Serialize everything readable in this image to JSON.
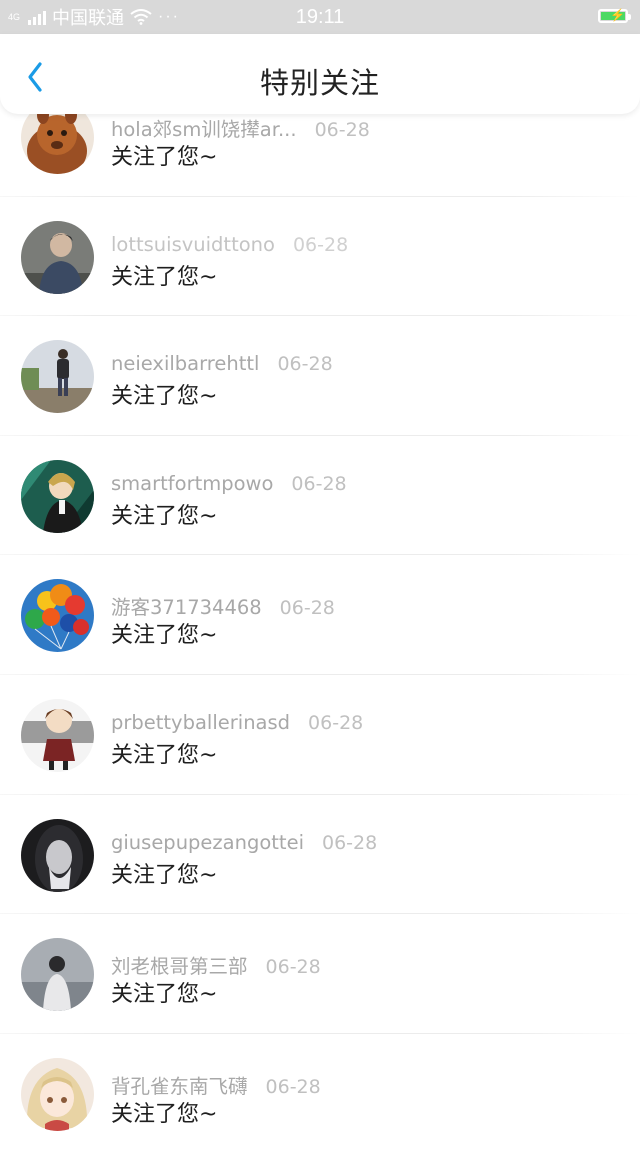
{
  "status_bar": {
    "signal_tag": "4G",
    "carrier": "中国联通",
    "more": "···",
    "time": "19:11",
    "battery_color": "#4cd964"
  },
  "header": {
    "title": "特别关注",
    "back_icon": "chevron-left-icon",
    "accent_color": "#1a9be6"
  },
  "list": {
    "items": [
      {
        "name": "hola郊sm训饶撵ar...",
        "date": "06-28",
        "message": "关注了您~",
        "avatar": "alpaca-avatar"
      },
      {
        "name": "lottsuisvuidttono",
        "date": "06-28",
        "message": "关注了您~",
        "avatar": "person-avatar"
      },
      {
        "name": "neiexilbarrehttl",
        "date": "06-28",
        "message": "关注了您~",
        "avatar": "backpacker-avatar"
      },
      {
        "name": "smartfortmpowo",
        "date": "06-28",
        "message": "关注了您~",
        "avatar": "anime-avatar"
      },
      {
        "name": "游客371734468",
        "date": "06-28",
        "message": "关注了您~",
        "avatar": "balloons-avatar"
      },
      {
        "name": "prbettyballerinasd",
        "date": "06-28",
        "message": "关注了您~",
        "avatar": "chibi-avatar"
      },
      {
        "name": "giusepupezangottei",
        "date": "06-28",
        "message": "关注了您~",
        "avatar": "hooded-avatar"
      },
      {
        "name": "刘老根哥第三部",
        "date": "06-28",
        "message": "关注了您~",
        "avatar": "boy-avatar"
      },
      {
        "name": "背孔雀东南飞礴",
        "date": "06-28",
        "message": "关注了您~",
        "avatar": "anime-girl-avatar"
      }
    ]
  }
}
